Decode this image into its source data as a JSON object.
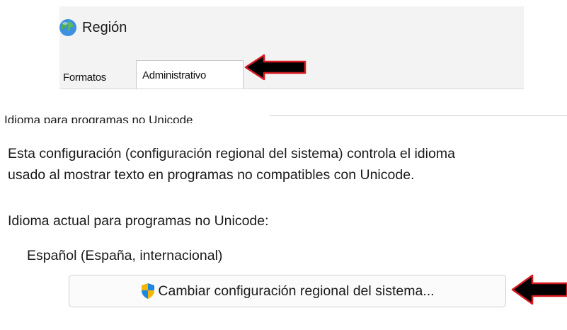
{
  "window": {
    "title": "Región",
    "icon": "globe-icon"
  },
  "tabs": [
    {
      "label": "Formatos",
      "selected": false
    },
    {
      "label": "Administrativo",
      "selected": true
    }
  ],
  "section": {
    "group_title": "Idioma para programas no Unicode",
    "description_line1": "Esta configuración (configuración regional del sistema) controla el idioma",
    "description_line2": "usado al mostrar texto en programas no compatibles con Unicode.",
    "current_label": "Idioma actual para programas no Unicode:",
    "current_value": "Español (España, internacional)",
    "change_button_label": "Cambiar configuración regional del sistema...",
    "change_button_icon": "uac-shield-icon"
  },
  "annotations": {
    "arrow_color": "#000000",
    "arrow_outline": "#d71920"
  }
}
